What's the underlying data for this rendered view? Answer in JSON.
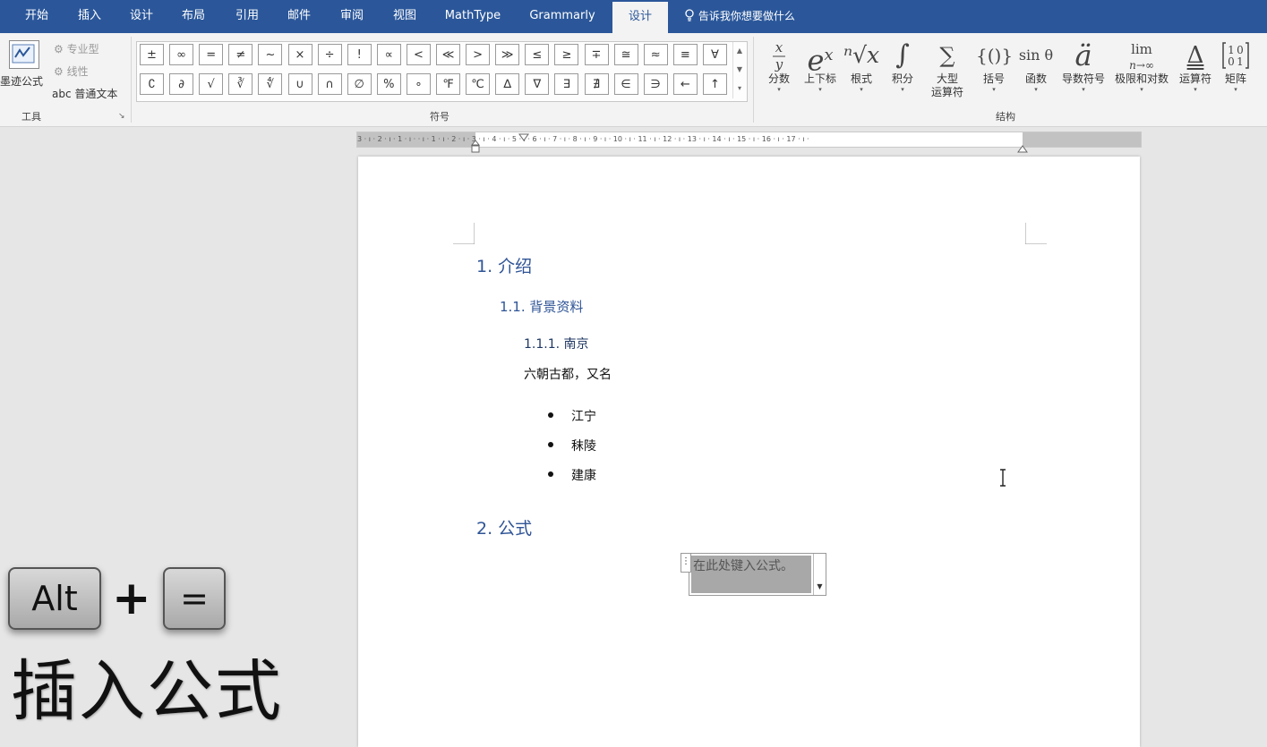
{
  "menubar": {
    "tabs": [
      {
        "label": "开始"
      },
      {
        "label": "插入"
      },
      {
        "label": "设计"
      },
      {
        "label": "布局"
      },
      {
        "label": "引用"
      },
      {
        "label": "邮件"
      },
      {
        "label": "审阅"
      },
      {
        "label": "视图"
      },
      {
        "label": "MathType"
      },
      {
        "label": "Grammarly"
      },
      {
        "label": "设计"
      }
    ],
    "tell_me": "告诉我你想要做什么"
  },
  "ribbon": {
    "tools": {
      "ink_equation": "墨迹公式",
      "professional": "专业型",
      "linear": "线性",
      "normal_text": "abc 普通文本",
      "group_label": "工具"
    },
    "symbols": {
      "row1": [
        "±",
        "∞",
        "=",
        "≠",
        "~",
        "×",
        "÷",
        "!",
        "∝",
        "<",
        "≪",
        ">",
        "≫",
        "≤",
        "≥",
        "∓",
        "≅",
        "≈",
        "≡",
        "∀"
      ],
      "row2": [
        "∁",
        "∂",
        "√",
        "∛",
        "∜",
        "∪",
        "∩",
        "∅",
        "%",
        "∘",
        "℉",
        "℃",
        "∆",
        "∇",
        "∃",
        "∄",
        "∈",
        "∋",
        "←",
        "↑"
      ],
      "group_label": "符号"
    },
    "structures": {
      "items": [
        {
          "glyph": "x/y",
          "label": "分数"
        },
        {
          "glyph": "eˣ",
          "label": "上下标"
        },
        {
          "glyph": "ⁿ√x",
          "label": "根式"
        },
        {
          "glyph": "∫",
          "label": "积分"
        },
        {
          "glyph": "∑",
          "label": "大型\n运算符"
        },
        {
          "glyph": "{()}",
          "label": "括号"
        },
        {
          "glyph": "sin θ",
          "label": "函数"
        },
        {
          "glyph": "ä",
          "label": "导数符号"
        },
        {
          "glyph": "lim",
          "label": "极限和对数"
        },
        {
          "glyph": "Δ",
          "label": "运算符"
        },
        {
          "glyph": "[10 01]",
          "label": "矩阵"
        }
      ],
      "group_label": "结构"
    }
  },
  "ruler": {
    "marks": "3 · ı · 2 · ı · 1 · ı · · ı · 1 · ı · 2 · ı · 3 · ı · 4 · ı · 5 · ı · 6 · ı · 7 · ı · 8 · ı · 9 · ı · 10 · ı · 11 · ı · 12 · ı · 13 · ı · 14 · ı · 15 · ı · 16 · ı · 17 · ı ·"
  },
  "document": {
    "heading1_intro": "1. 介绍",
    "heading2_background": "1.1. 背景资料",
    "heading3_nanjing": "1.1.1.   南京",
    "body_text": "六朝古都，又名",
    "bullets": [
      "江宁",
      "秣陵",
      "建康"
    ],
    "heading1_formula": "2. 公式",
    "equation_placeholder": "在此处键入公式。"
  },
  "overlay": {
    "key1": "Alt",
    "plus": "+",
    "key2": "=",
    "caption": "插入公式"
  }
}
